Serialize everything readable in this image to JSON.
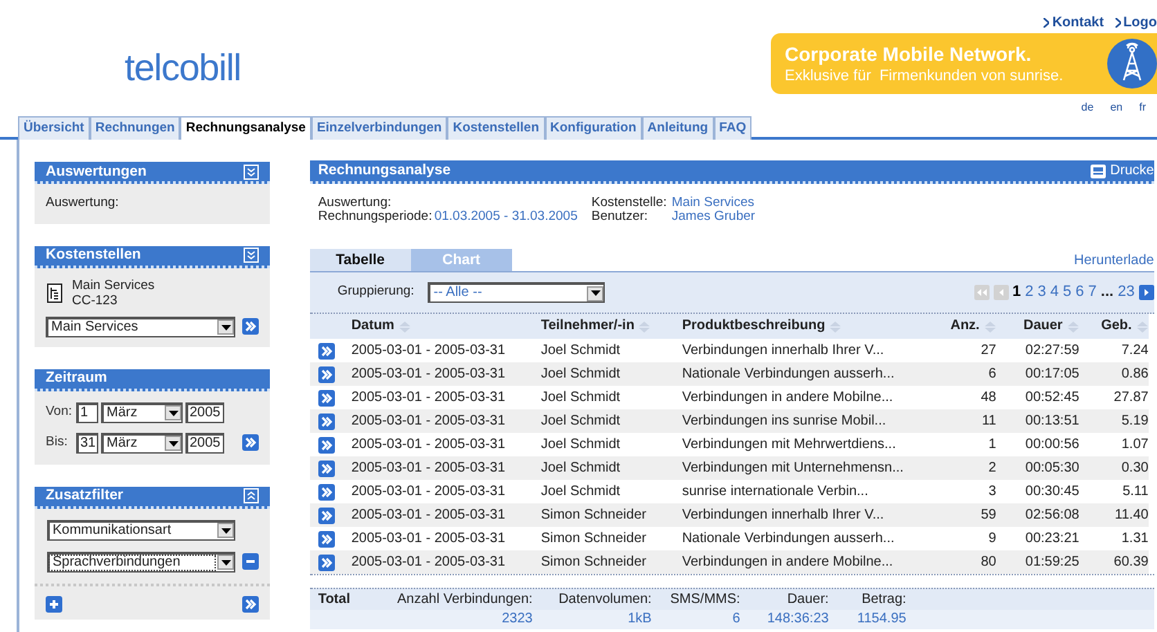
{
  "header": {
    "top_links": [
      "Kontakt",
      "Logo"
    ],
    "logo": "telcobill",
    "banner": {
      "title": "Corporate Mobile Network.",
      "subtitle": "Exklusive für  Firmenkunden von sunrise."
    },
    "languages": [
      "de",
      "en",
      "fr"
    ]
  },
  "nav_tabs": [
    {
      "label": "Übersicht",
      "selected": false
    },
    {
      "label": "Rechnungen",
      "selected": false
    },
    {
      "label": "Rechnungsanalyse",
      "selected": true
    },
    {
      "label": "Einzelverbindungen",
      "selected": false
    },
    {
      "label": "Kostenstellen",
      "selected": false
    },
    {
      "label": "Konfiguration",
      "selected": false
    },
    {
      "label": "Anleitung",
      "selected": false
    },
    {
      "label": "FAQ",
      "selected": false
    }
  ],
  "sidebar": [
    {
      "kind": "auswertung",
      "title": "Auswertungen",
      "expanded": false,
      "label": "Auswertung:"
    },
    {
      "kind": "kostenstellen",
      "title": "Kostenstellen",
      "expanded": false,
      "name": "Main Services",
      "code": "CC-123",
      "select": "Main Services"
    },
    {
      "kind": "zeitraum",
      "title": "Zeitraum",
      "from": {
        "label": "Von:",
        "day": "1",
        "month": "März",
        "year": "2005"
      },
      "to": {
        "label": "Bis:",
        "day": "31",
        "month": "März",
        "year": "2005"
      }
    },
    {
      "kind": "zusatzfilter",
      "title": "Zusatzfilter",
      "expanded": true,
      "filters": [
        "Kommunikationsart",
        "Sprachverbindungen"
      ]
    }
  ],
  "report": {
    "title": "Rechnungsanalyse",
    "print_label": "Drucke",
    "info_left": [
      {
        "label": "Auswertung:"
      },
      {
        "label": "Rechnungsperiode:",
        "value": "01.03.2005 - 31.03.2005"
      }
    ],
    "info_right": [
      {
        "label": "Kostenstelle:",
        "value": "Main Services"
      },
      {
        "label": "Benutzer:",
        "value": "James Gruber"
      }
    ],
    "view_tabs": [
      {
        "label": "Tabelle",
        "selected": true
      },
      {
        "label": "Chart",
        "selected": false
      }
    ],
    "download": "Herunterlade",
    "grouping": {
      "label": "Gruppierung:",
      "value": "-- Alle --"
    },
    "pagination": {
      "first_disabled": true,
      "prev_disabled": true,
      "next_disabled": false,
      "pages": [
        {
          "label": "1",
          "selected": true
        },
        {
          "label": "2",
          "selected": false
        },
        {
          "label": "3",
          "selected": false
        },
        {
          "label": "4",
          "selected": false
        },
        {
          "label": "5",
          "selected": false
        },
        {
          "label": "6",
          "selected": false
        },
        {
          "label": "7",
          "selected": false
        },
        {
          "label": "23",
          "selected": false
        }
      ],
      "ellipsis": "..."
    }
  },
  "table": {
    "columns": [
      "Datum",
      "Teilnehmer/-in",
      "Produktbeschreibung",
      "Anz.",
      "Dauer",
      "Geb."
    ],
    "rows": [
      [
        "2005-03-01 - 2005-03-31",
        "Joel Schmidt",
        "Verbindungen innerhalb Ihrer V...",
        "27",
        "02:27:59",
        "7.24"
      ],
      [
        "2005-03-01 - 2005-03-31",
        "Joel Schmidt",
        "Nationale Verbindungen ausserh...",
        "6",
        "00:17:05",
        "0.86"
      ],
      [
        "2005-03-01 - 2005-03-31",
        "Joel Schmidt",
        "Verbindungen in andere Mobilne...",
        "48",
        "00:52:45",
        "27.87"
      ],
      [
        "2005-03-01 - 2005-03-31",
        "Joel Schmidt",
        "Verbindungen ins sunrise Mobil...",
        "11",
        "00:13:51",
        "5.19"
      ],
      [
        "2005-03-01 - 2005-03-31",
        "Joel Schmidt",
        "Verbindungen mit Mehrwertdiens...",
        "1",
        "00:00:56",
        "1.07"
      ],
      [
        "2005-03-01 - 2005-03-31",
        "Joel Schmidt",
        "Verbindungen mit Unternehmensn...",
        "2",
        "00:05:30",
        "0.30"
      ],
      [
        "2005-03-01 - 2005-03-31",
        "Joel Schmidt",
        "sunrise internationale Verbin...",
        "3",
        "00:30:45",
        "5.11"
      ],
      [
        "2005-03-01 - 2005-03-31",
        "Simon Schneider",
        "Verbindungen innerhalb Ihrer V...",
        "59",
        "02:56:08",
        "11.40"
      ],
      [
        "2005-03-01 - 2005-03-31",
        "Simon Schneider",
        "Nationale Verbindungen ausserh...",
        "9",
        "00:23:21",
        "1.31"
      ],
      [
        "2005-03-01 - 2005-03-31",
        "Simon Schneider",
        "Verbindungen in andere Mobilne...",
        "80",
        "01:59:25",
        "60.39"
      ]
    ]
  },
  "totals": {
    "label": "Total",
    "items": [
      {
        "label": "Anzahl Verbindungen:",
        "value": "2323"
      },
      {
        "label": "Datenvolumen:",
        "value": "1kB"
      },
      {
        "label": "SMS/MMS:",
        "value": "6"
      },
      {
        "label": "Dauer:",
        "value": "148:36:23"
      },
      {
        "label": "Betrag:",
        "value": "1154.95"
      }
    ]
  }
}
